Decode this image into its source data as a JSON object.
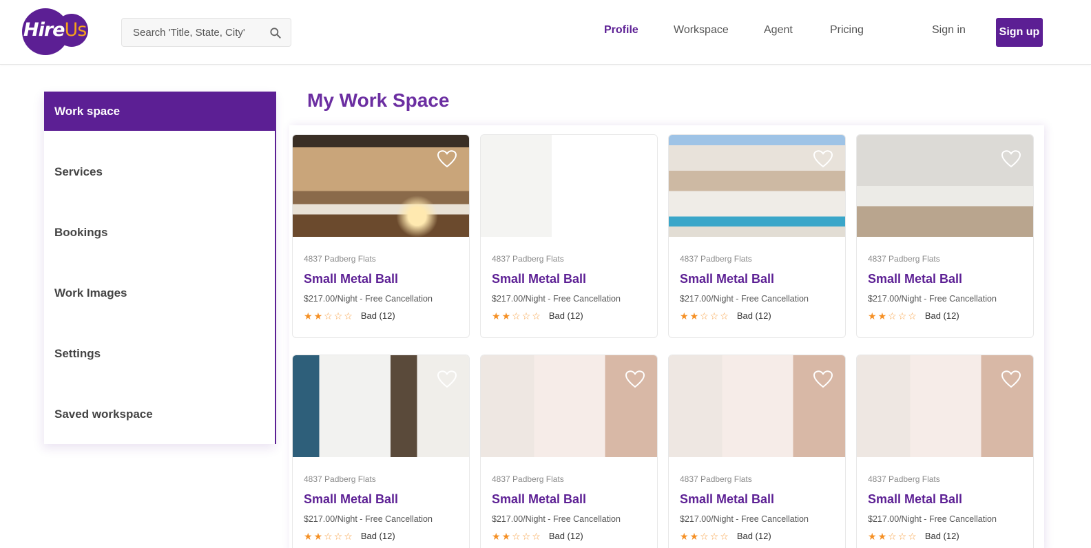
{
  "brand": {
    "logo_text_a": "Hire",
    "logo_text_b": "Us"
  },
  "search": {
    "placeholder": "Search 'Title, State, City'"
  },
  "nav": {
    "profile": "Profile",
    "workspace": "Workspace",
    "agent": "Agent",
    "pricing": "Pricing",
    "sign_in": "Sign in",
    "sign_up": "Sign up"
  },
  "sidebar": {
    "items": [
      {
        "label": "Work space"
      },
      {
        "label": "Services"
      },
      {
        "label": "Bookings"
      },
      {
        "label": "Work Images"
      },
      {
        "label": "Settings"
      },
      {
        "label": "Saved workspace"
      }
    ]
  },
  "main": {
    "title": "My Work Space",
    "cards": [
      {
        "address": "4837 Padberg Flats",
        "title": "Small Metal Ball",
        "price": "$217.00/Night - Free Cancellation",
        "rating_text": "Bad (12)",
        "stars": 2
      },
      {
        "address": "4837 Padberg Flats",
        "title": "Small Metal Ball",
        "price": "$217.00/Night - Free Cancellation",
        "rating_text": "Bad (12)",
        "stars": 2
      },
      {
        "address": "4837 Padberg Flats",
        "title": "Small Metal Ball",
        "price": "$217.00/Night - Free Cancellation",
        "rating_text": "Bad (12)",
        "stars": 2
      },
      {
        "address": "4837 Padberg Flats",
        "title": "Small Metal Ball",
        "price": "$217.00/Night - Free Cancellation",
        "rating_text": "Bad (12)",
        "stars": 2
      },
      {
        "address": "4837 Padberg Flats",
        "title": "Small Metal Ball",
        "price": "$217.00/Night - Free Cancellation",
        "rating_text": "Bad (12)",
        "stars": 2
      },
      {
        "address": "4837 Padberg Flats",
        "title": "Small Metal Ball",
        "price": "$217.00/Night - Free Cancellation",
        "rating_text": "Bad (12)",
        "stars": 2
      },
      {
        "address": "4837 Padberg Flats",
        "title": "Small Metal Ball",
        "price": "$217.00/Night - Free Cancellation",
        "rating_text": "Bad (12)",
        "stars": 2
      },
      {
        "address": "4837 Padberg Flats",
        "title": "Small Metal Ball",
        "price": "$217.00/Night - Free Cancellation",
        "rating_text": "Bad (12)",
        "stars": 2
      }
    ]
  },
  "colors": {
    "brand_purple": "#5c1f94",
    "accent_orange": "#f59025"
  }
}
